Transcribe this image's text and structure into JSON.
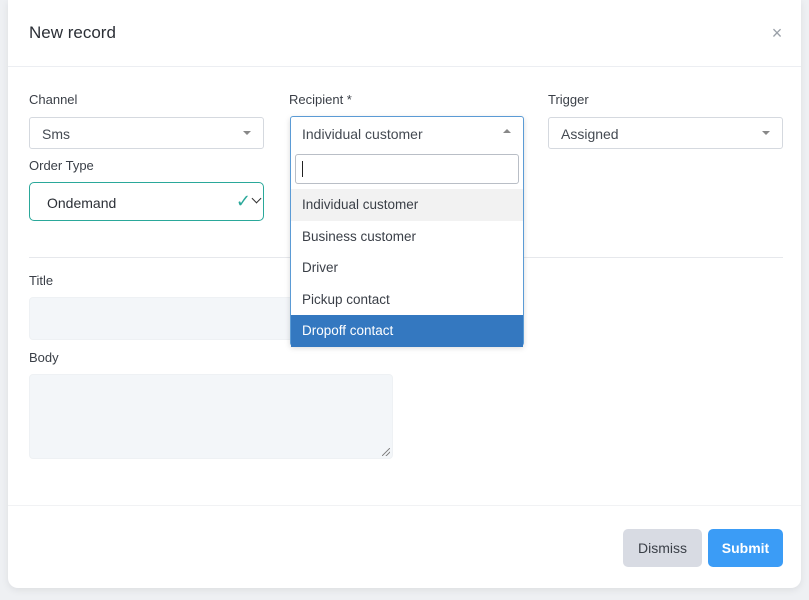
{
  "modal": {
    "title": "New record",
    "close_glyph": "×"
  },
  "fields": {
    "channel": {
      "label": "Channel",
      "value": "Sms"
    },
    "recipient": {
      "label": "Recipient *",
      "value": "Individual customer"
    },
    "trigger": {
      "label": "Trigger",
      "value": "Assigned"
    },
    "order_type": {
      "label": "Order Type",
      "value": "Ondemand"
    },
    "title": {
      "label": "Title",
      "value": ""
    },
    "body": {
      "label": "Body",
      "value": ""
    }
  },
  "recipient_dropdown": {
    "search_value": "",
    "options": [
      "Individual customer",
      "Business customer",
      "Driver",
      "Pickup contact",
      "Dropoff contact"
    ],
    "hovered_index": 0,
    "highlighted_index": 4
  },
  "buttons": {
    "dismiss": "Dismiss",
    "submit": "Submit"
  },
  "colors": {
    "accent_teal": "#2aa89a",
    "submit_blue": "#3b9cf6",
    "highlight_blue": "#3478c0"
  },
  "icons": {
    "close": "close-icon",
    "check": "check-icon",
    "chevron": "chevron-down-icon"
  }
}
